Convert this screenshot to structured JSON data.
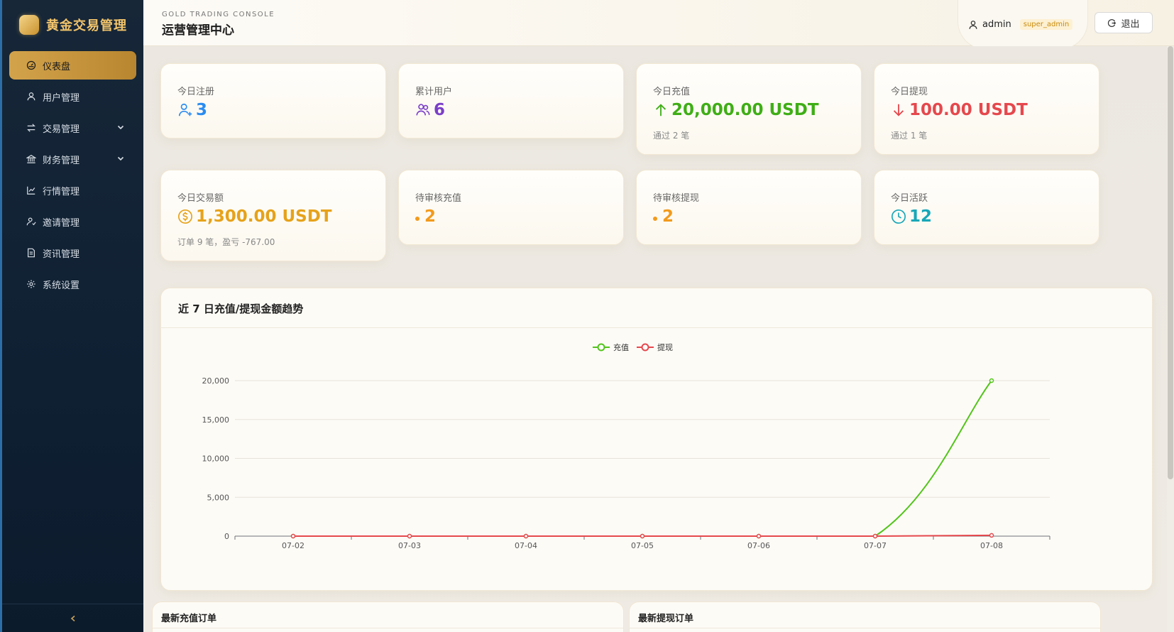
{
  "brand": {
    "name": "黄金交易管理"
  },
  "sidebar": {
    "items": [
      {
        "label": "仪表盘",
        "icon": "dashboard-icon",
        "active": true
      },
      {
        "label": "用户管理",
        "icon": "user-icon"
      },
      {
        "label": "交易管理",
        "icon": "exchange-icon",
        "expandable": true
      },
      {
        "label": "财务管理",
        "icon": "bank-icon",
        "expandable": true
      },
      {
        "label": "行情管理",
        "icon": "line-chart-icon"
      },
      {
        "label": "邀请管理",
        "icon": "invite-icon"
      },
      {
        "label": "资讯管理",
        "icon": "document-icon"
      },
      {
        "label": "系统设置",
        "icon": "gear-icon"
      }
    ],
    "collapse_label": "<"
  },
  "header": {
    "subtitle": "GOLD TRADING CONSOLE",
    "title": "运营管理中心",
    "user": "admin",
    "role": "super_admin",
    "logout_label": "退出"
  },
  "stats": {
    "today_register": {
      "label": "今日注册",
      "value": "3",
      "color": "#2a8cf0"
    },
    "total_users": {
      "label": "累计用户",
      "value": "6",
      "color": "#7b3fc8"
    },
    "today_recharge": {
      "label": "今日充值",
      "value": "20,000.00 USDT",
      "sub": "通过 2 笔",
      "color": "#3fae16"
    },
    "today_withdraw": {
      "label": "今日提现",
      "value": "100.00 USDT",
      "sub": "通过 1 笔",
      "color": "#e5484d"
    },
    "today_trade": {
      "label": "今日交易额",
      "value": "1,300.00 USDT",
      "sub": "订单 9 笔，盈亏 -767.00",
      "color": "#e6a21a"
    },
    "pending_recharge": {
      "label": "待审核充值",
      "value": "2",
      "color": "#f29a1c"
    },
    "pending_withdraw": {
      "label": "待审核提现",
      "value": "2",
      "color": "#f29a1c"
    },
    "today_active": {
      "label": "今日活跃",
      "value": "12",
      "color": "#17a7b8"
    }
  },
  "chart": {
    "title": "近 7 日充值/提现金额趋势"
  },
  "chart_data": {
    "type": "line",
    "title": "近 7 日充值/提现金额趋势",
    "x": [
      "07-02",
      "07-03",
      "07-04",
      "07-05",
      "07-06",
      "07-07",
      "07-08"
    ],
    "series": [
      {
        "name": "充值",
        "color": "#52c41a",
        "values": [
          0,
          0,
          0,
          0,
          0,
          0,
          20000
        ]
      },
      {
        "name": "提现",
        "color": "#e5484d",
        "values": [
          0,
          0,
          0,
          0,
          0,
          0,
          100
        ]
      }
    ],
    "yticks": [
      "0",
      "5,000",
      "10,000",
      "15,000",
      "20,000"
    ],
    "ylim": [
      0,
      20000
    ],
    "legend": "top-center",
    "grid": true
  },
  "orders": {
    "recharge_title": "最新充值订单",
    "withdraw_title": "最新提现订单"
  }
}
